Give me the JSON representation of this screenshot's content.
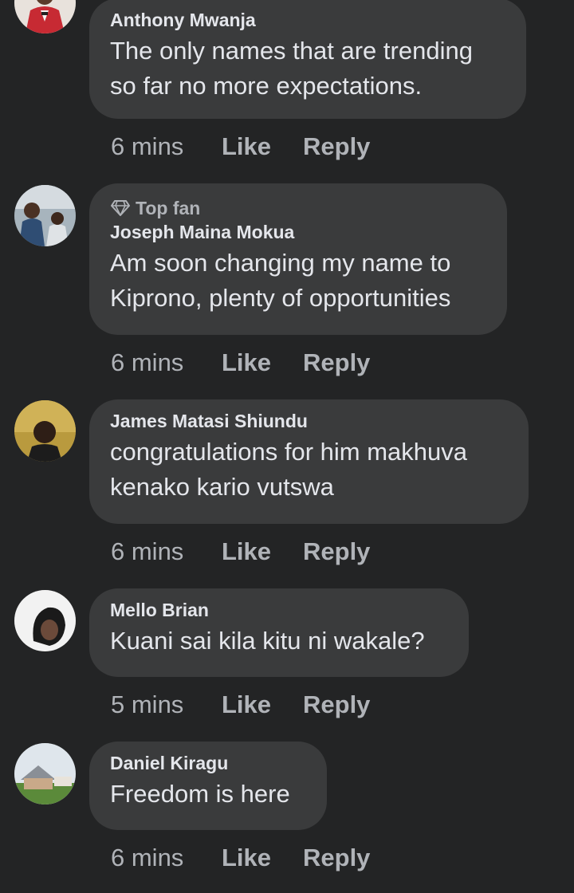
{
  "colors": {
    "background": "#232425",
    "bubble": "#3a3b3c",
    "primary_text": "#e4e6eb",
    "secondary_text": "#b0b3b8"
  },
  "comments": [
    {
      "author": "Anthony Mwanja",
      "text_lines": [
        "The only names that are trending",
        "so far no more expectations."
      ],
      "time": "6 mins",
      "like_label": "Like",
      "reply_label": "Reply"
    },
    {
      "badge_icon": "diamond-icon",
      "badge": "Top fan",
      "author": "Joseph Maina Mokua",
      "text_lines": [
        "Am soon changing my name to",
        "Kiprono, plenty of opportunities"
      ],
      "time": "6 mins",
      "like_label": "Like",
      "reply_label": "Reply"
    },
    {
      "author": "James Matasi Shiundu",
      "text_lines": [
        "congratulations for him makhuva",
        "kenako kario vutswa"
      ],
      "time": "6 mins",
      "like_label": "Like",
      "reply_label": "Reply"
    },
    {
      "author": "Mello Brian",
      "text_lines": [
        "Kuani sai kila kitu ni wakale?"
      ],
      "time": "5 mins",
      "like_label": "Like",
      "reply_label": "Reply"
    },
    {
      "author": "Daniel Kiragu",
      "text_lines": [
        "Freedom is here"
      ],
      "time": "6 mins",
      "like_label": "Like",
      "reply_label": "Reply"
    }
  ]
}
